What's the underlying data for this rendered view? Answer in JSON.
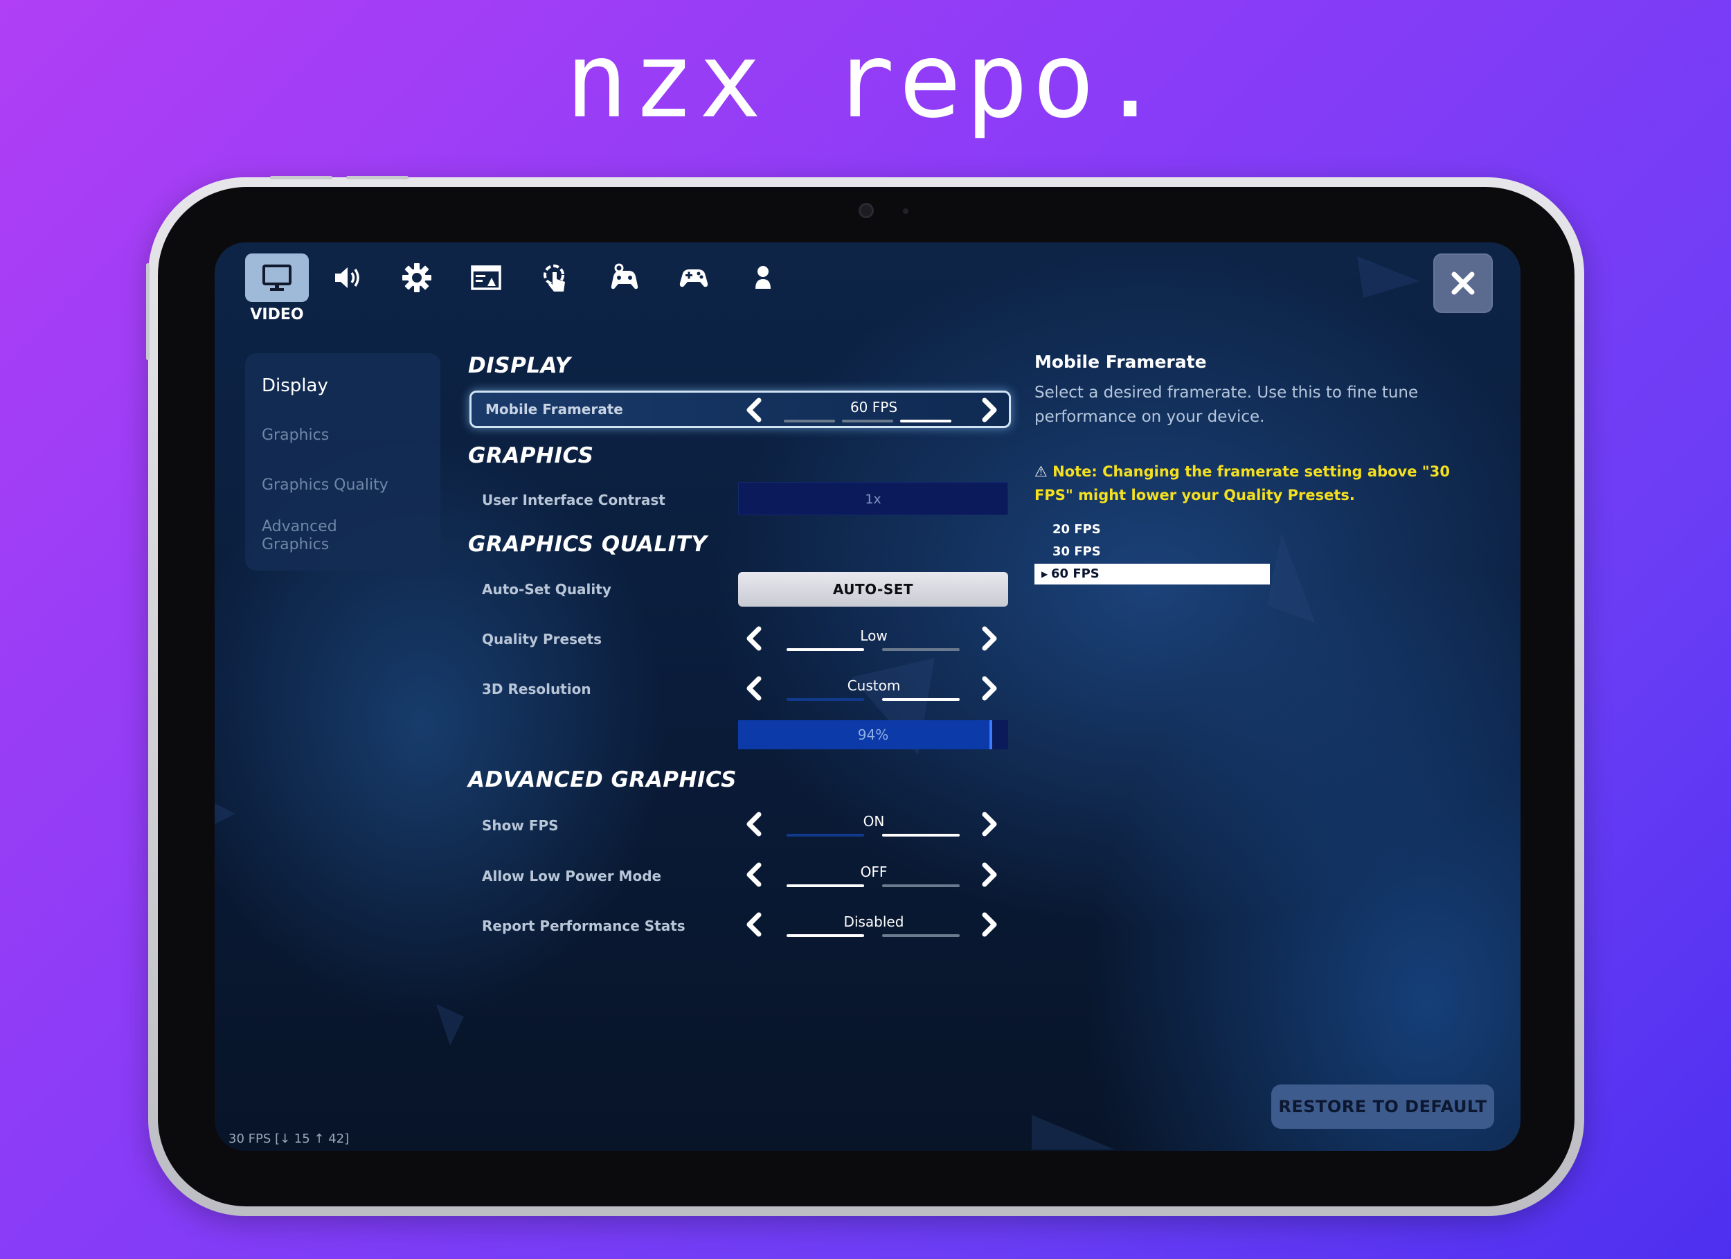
{
  "brand": "nzx repo.",
  "tabs": [
    {
      "icon": "monitor-icon",
      "label": "VIDEO",
      "active": true
    },
    {
      "icon": "speaker-icon"
    },
    {
      "icon": "gear-icon"
    },
    {
      "icon": "hud-icon"
    },
    {
      "icon": "touch-icon"
    },
    {
      "icon": "controller-settings-icon"
    },
    {
      "icon": "gamepad-icon"
    },
    {
      "icon": "account-icon"
    }
  ],
  "sidebar": {
    "items": [
      "Display",
      "Graphics",
      "Graphics Quality",
      "Advanced\nGraphics"
    ],
    "active_index": 0
  },
  "sections": {
    "display": "DISPLAY",
    "graphics": "GRAPHICS",
    "graphics_quality": "GRAPHICS QUALITY",
    "advanced_graphics": "ADVANCED GRAPHICS"
  },
  "settings": {
    "mobile_framerate": {
      "label": "Mobile Framerate",
      "value": "60 FPS",
      "option_index": 2,
      "option_count": 3
    },
    "ui_contrast": {
      "label": "User Interface Contrast",
      "value": "1x"
    },
    "auto_set_quality": {
      "label": "Auto-Set Quality",
      "button": "AUTO-SET"
    },
    "quality_presets": {
      "label": "Quality Presets",
      "value": "Low",
      "option_index": 0,
      "option_count": 2
    },
    "resolution_3d": {
      "label": "3D Resolution",
      "value": "Custom",
      "option_index": 1,
      "option_count": 2,
      "percent": "94%",
      "fraction": 0.94
    },
    "show_fps": {
      "label": "Show FPS",
      "value": "ON",
      "option_index": 1,
      "option_count": 2
    },
    "low_power_mode": {
      "label": "Allow Low Power Mode",
      "value": "OFF",
      "option_index": 0,
      "option_count": 2
    },
    "report_stats": {
      "label": "Report Performance Stats",
      "value": "Disabled",
      "option_index": 0,
      "option_count": 2
    }
  },
  "info": {
    "title": "Mobile Framerate",
    "description": "Select a desired framerate. Use this to fine tune performance on your device.",
    "note": "Note: Changing the framerate setting above \"30 FPS\" might lower your Quality Presets.",
    "options": [
      "20 FPS",
      "30 FPS",
      "60 FPS"
    ],
    "selected_index": 2
  },
  "restore_label": "RESTORE TO DEFAULT",
  "fps_counter": "30 FPS [↓ 15 ↑ 42]",
  "colors": {
    "accent": "#9fb9d8",
    "note": "#f5e020",
    "background_top": "#b03ff5",
    "background_bottom": "#4e2ff0"
  }
}
